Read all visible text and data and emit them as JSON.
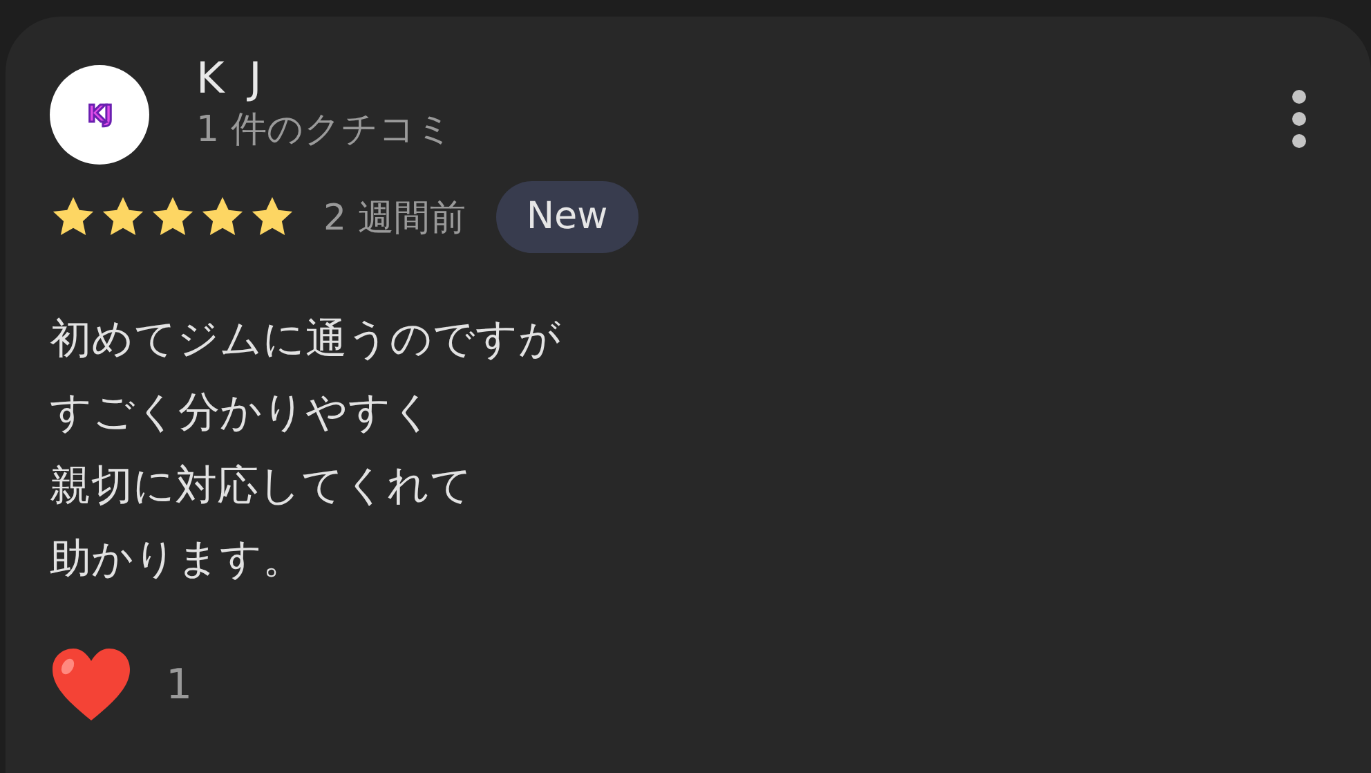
{
  "review": {
    "avatar_text": "KJ",
    "author": "K J",
    "review_count": "1 件のクチコミ",
    "stars": 5,
    "time": "2 週間前",
    "badge": "New",
    "text_lines": [
      "初めてジムに通うのですが",
      "すごく分かりやすく",
      "親切に対応してくれて",
      "助かります。"
    ],
    "reaction_count": "1"
  }
}
